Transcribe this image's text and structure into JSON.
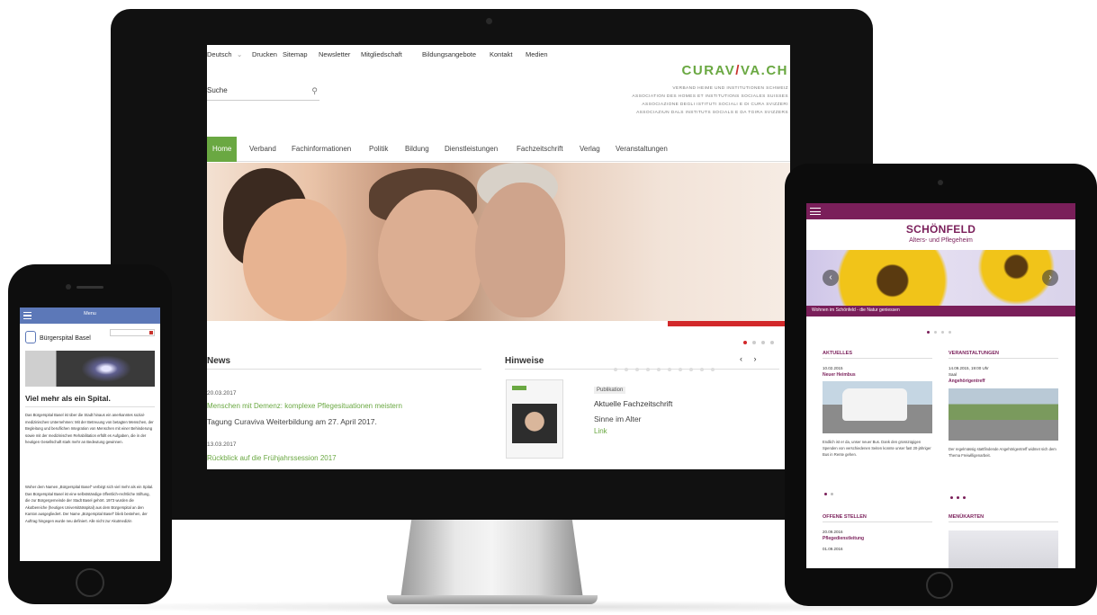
{
  "imac": {
    "topnav": [
      "Deutsch",
      "Drucken",
      "Sitemap",
      "Newsletter",
      "Mitgliedschaft",
      "Bildungsangebote",
      "Kontakt",
      "Medien"
    ],
    "search_placeholder": "Suche",
    "logo_part1": "CURAV",
    "logo_part2": "/",
    "logo_part3": "VA.CH",
    "logo_sub": [
      "VERBAND HEIME UND INSTITUTIONEN SCHWEIZ",
      "ASSOCIATION DES HOMES ET INSTITUTIONS SOCIALES SUISSES",
      "ASSOCIAZIONE DEGLI ISTITUTI SOCIALI E DI CURA SVIZZERI",
      "ASSOCIAZIUN DALS INSTITUTS SOCIALS E DA TGIRA SVIZZERS"
    ],
    "mainnav": [
      "Home",
      "Verband",
      "Fachinformationen",
      "Politik",
      "Bildung",
      "Dienstleistungen",
      "Fachzeitschrift",
      "Verlag",
      "Veranstaltungen"
    ],
    "news": {
      "heading": "News",
      "items": [
        {
          "date": "20.03.2017",
          "title": "Menschen mit Demenz: komplexe Pflegesituationen meistern",
          "text": "Tagung Curaviva Weiterbildung am 27. April 2017."
        },
        {
          "date": "13.03.2017",
          "title": "Rückblick auf die Frühjahrssession 2017"
        }
      ]
    },
    "hinweise": {
      "heading": "Hinweise",
      "arrow_prev": "‹",
      "arrow_next": "›",
      "badge": "Publikation",
      "title": "Aktuelle Fachzeitschrift",
      "subtitle": "Sinne im Alter",
      "link": "Link"
    }
  },
  "phone": {
    "bar_title": "Menu",
    "site_name": "Bürgerspital Basel",
    "heading": "Viel mehr als ein Spital.",
    "paragraphs": [
      "Das Bürgerspital Basel ist über die Stadt hinaus ein anerkanntes sozial-medizinisches Unternehmen: Mit der Betreuung von betagten Menschen, der Begleitung und beruflichen Integration von Menschen mit einer Behinderung sowie mit der medizinischen Rehabilitation erfüllt es Aufgaben, die in der heutigen Gesellschaft stark mehr an Bedeutung gewinnen.",
      "Woher dem Namen „Bürgerspital Basel\" verbirgt sich viel mehr als ein Spital. Das Bürgerspital Basel ist eine selbstständige öffentlich-rechtliche Stiftung, die zur Bürgergemeinde der Stadt Basel gehört. 1973 wurden die Akutbereiche (heutiges Universitätsspital) aus dem Bürgerspital an den Kanton ausgegliedert. Der Name „Bürgerspital Basel\" blieb bestehen, der Auftrag hingegen wurde neu definiert. Alle nicht zur Akutmedizin"
    ]
  },
  "tablet": {
    "brand": "SCHÖNFELD",
    "tagline": "Alters- und Pflegeheim",
    "caption": "Wohnen im Schönfeld - die Natur geniessen",
    "arrow_prev": "‹",
    "arrow_next": "›",
    "aktuelles": {
      "heading": "AKTUELLES",
      "date": "10.02.2015",
      "title": "Neuer Heimbus",
      "text": "Endlich ist er da, unser neuer Bus. Dank den grosszügigen Spenden von verschiedenen Seiten konnte unser fast 20-jähriger Bus in Rente gehen."
    },
    "veranstaltungen": {
      "heading": "VERANSTALTUNGEN",
      "date": "14.09.2015, 19:00 Uhr",
      "place": "Saal",
      "title": "Angehörigentreff",
      "text": "Der regelmässig stattfindende Angehörigentreff widmet sich dem Thema Freiwilligenarbeit."
    },
    "offene_stellen": {
      "heading": "OFFENE STELLEN",
      "date": "20.09.2016",
      "title": "Pflegedienstleitung",
      "date2": "01.09.2016"
    },
    "menukarten": {
      "heading": "MENÜKARTEN"
    }
  }
}
